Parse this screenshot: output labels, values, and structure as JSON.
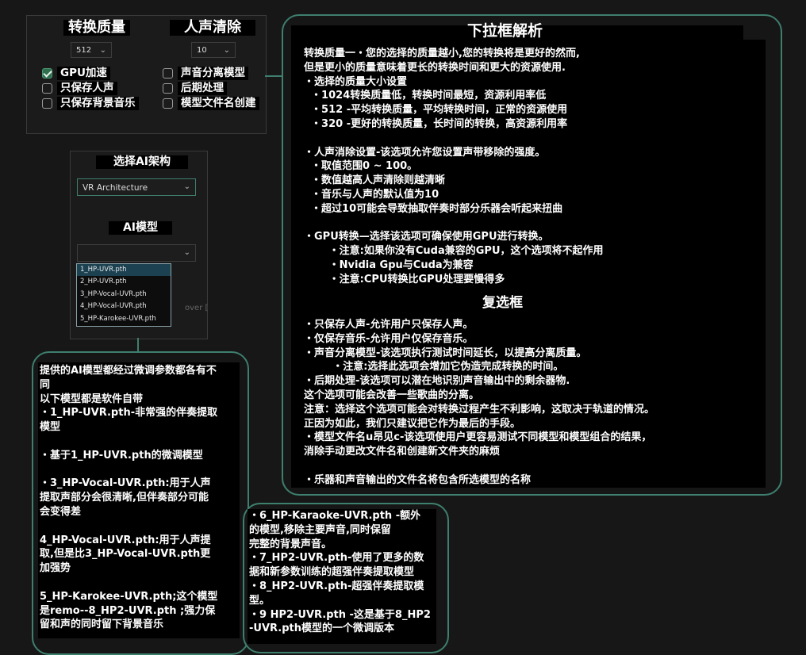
{
  "settings_panel": {
    "quality_title": "转换质量",
    "vocal_title": "人声清除",
    "quality_value": "512",
    "vocal_value": "10",
    "checkboxes_left": [
      {
        "label": "GPU加速",
        "checked": true
      },
      {
        "label": "只保存人声",
        "checked": false
      },
      {
        "label": "只保存背景音乐",
        "checked": false
      }
    ],
    "checkboxes_right": [
      {
        "label": "声音分离模型",
        "checked": false
      },
      {
        "label": "后期处理",
        "checked": false
      },
      {
        "label": "模型文件名创建",
        "checked": false
      }
    ]
  },
  "arch_panel": {
    "arch_title": "选择AI架构",
    "arch_value": "VR Architecture",
    "model_title": "AI模型",
    "model_value": "",
    "model_options": [
      "1_HP-UVR.pth",
      "2_HP-UVR.pth",
      "3_HP-Vocal-UVR.pth",
      "4_HP-Vocal-UVR.pth",
      "5_HP-Karokee-UVR.pth"
    ],
    "partial_text": "over ["
  },
  "explain_bubble": {
    "title": "下拉框解析",
    "section_one": "转换质量一・您的选择的质量越小,您的转换将是更好的然而,\n但是更小的质量意味着更长的转换时间和更大的资源使用.\n・选择的质量大小设置\n  ・1024转换质量低，转换时间最短，资源利用率低\n  ・512 -平均转换质量，平均转换时间，正常的资源使用\n  ・320 -更好的转换质量，长时间的转换，高资源利用率\n\n・人声消除设置-该选项允许您设置声带移除的强度。\n  ・取值范围0 ~ 100。\n  ・数值越高人声清除则越清晰\n  ・音乐与人声的默认值为10\n  ・超过10可能会导致抽取伴奏时部分乐器会听起来扭曲\n\n・GPU转换—选择该选项可确保使用GPU进行转换。\n       ・注意:如果你没有Cuda兼容的GPU，这个选项将不起作用\n       ・Nvidia Gpu与Cuda为兼容\n       ・注意:CPU转换比GPU处理要慢得多",
    "subtitle": "复选框",
    "section_two": "・只保存人声-允许用户只保存人声。\n・仅保存音乐-允许用户仅保存音乐。\n・声音分离模型-该选项执行测试时间延长，以提高分离质量。\n        ・注意:选择此选项会增加它伪造完成转换的时间。\n・后期处理-该选项可以潜在地识别声音输出中的剩余器物.\n这个选项可能会改善一些歌曲的分离。\n注意：选择这个选项可能会对转换过程产生不利影响，这取决于轨道的情况。\n正因为如此，我们只建议把它作为最后的手段。\n・模型文件名u昂见c-该选项使用户更容易测试不同模型和模型组合的结果，\n消除手动更改文件名和创建新文件夹的麻烦\n\n・乐器和声音输出的文件名将包含所选模型的名称"
  },
  "models_bubble": {
    "text": "提供的AI模型都经过微调参数都各有不\n同\n以下模型都是软件自带\n・1_HP-UVR.pth-非常强的伴奏提取\n模型\n\n・基于1_HP-UVR.pth的微调模型\n\n・3_HP-Vocal-UVR.pth:用于人声\n提取声部分会很清晰,但伴奏部分可能\n会变得差\n\n4_HP-Vocal-UVR.pth:用于人声提\n取,但是比3_HP-Vocal-UVR.pth更\n加强势\n\n5_HP-Karokee-UVR.pth;这个模型\n是remo--8_HP2-UVR.pth ;强力保\n留和声的同时留下背景音乐"
  },
  "models_bubble_two": {
    "text": "・6_HP-Karaoke-UVR.pth -额外\n的模型,移除主要声音,同时保留\n完整的背景声音。\n・7_HP2-UVR.pth-使用了更多的数\n据和新参数训练的超强伴奏提取模型\n・8_HP2-UVR.pth-超强伴奏提取模\n型。\n・9 HP2-UVR.pth -这是基于8_HP2\n-UVR.pth模型的一个微调版本"
  },
  "colors": {
    "accent": "#3e7f6e",
    "background": "#171717",
    "checkbox_checked": "#2f6f4e"
  }
}
